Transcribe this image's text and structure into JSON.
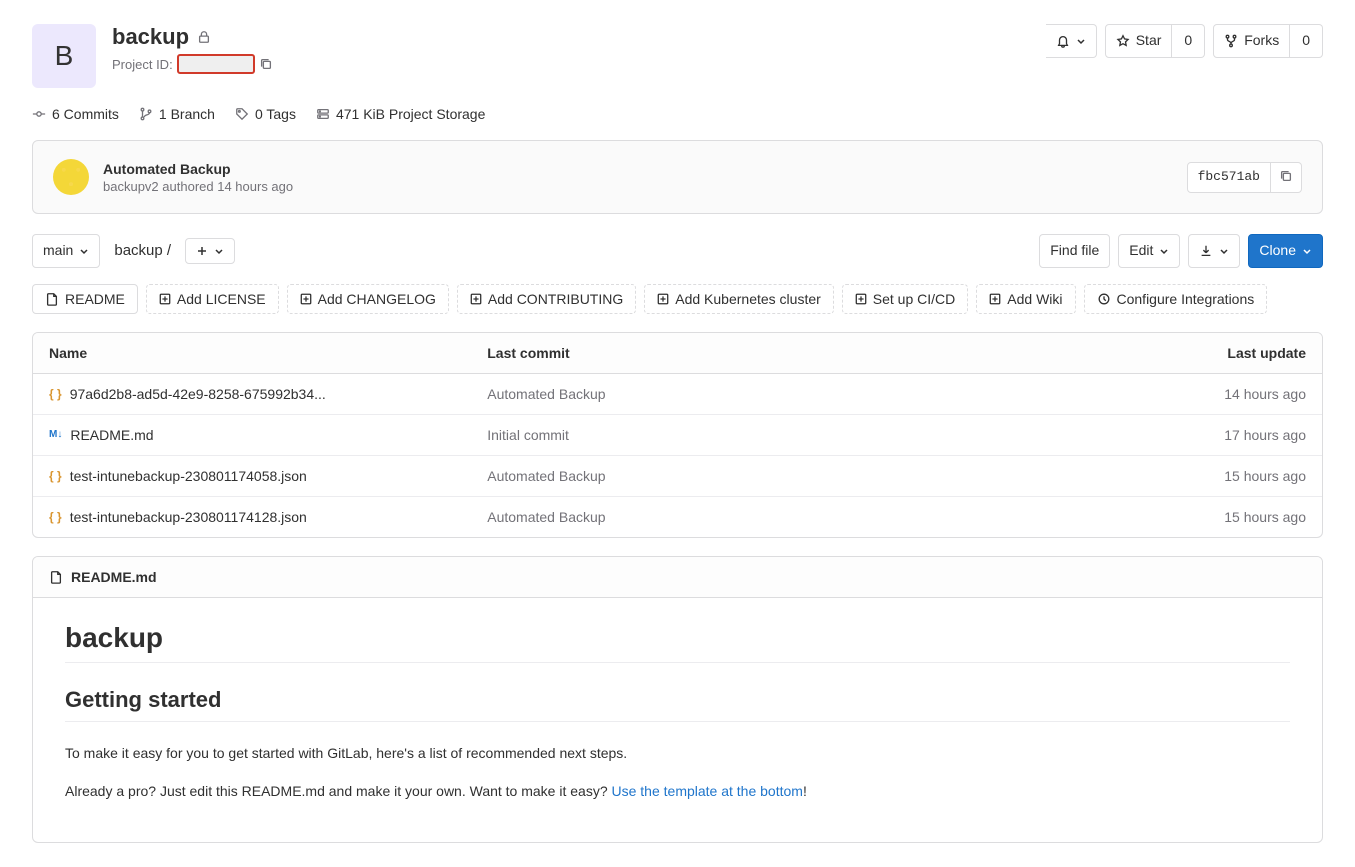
{
  "project": {
    "avatar_letter": "B",
    "name": "backup",
    "id_label": "Project ID:"
  },
  "actions": {
    "star": "Star",
    "star_count": "0",
    "forks": "Forks",
    "forks_count": "0"
  },
  "stats": {
    "commits": "6 Commits",
    "branches": "1 Branch",
    "tags": "0 Tags",
    "storage": "471 KiB Project Storage"
  },
  "last_commit": {
    "title": "Automated Backup",
    "author": "backupv2",
    "verb": "authored",
    "when": "14 hours ago",
    "sha": "fbc571ab"
  },
  "controls": {
    "branch": "main",
    "breadcrumb": "backup",
    "find_file": "Find file",
    "edit": "Edit",
    "clone": "Clone"
  },
  "quick_actions": [
    "README",
    "Add LICENSE",
    "Add CHANGELOG",
    "Add CONTRIBUTING",
    "Add Kubernetes cluster",
    "Set up CI/CD",
    "Add Wiki",
    "Configure Integrations"
  ],
  "table": {
    "headers": {
      "name": "Name",
      "commit": "Last commit",
      "update": "Last update"
    },
    "rows": [
      {
        "icon": "json",
        "name": "97a6d2b8-ad5d-42e9-8258-675992b34...",
        "commit": "Automated Backup",
        "update": "14 hours ago"
      },
      {
        "icon": "md",
        "name": "README.md",
        "commit": "Initial commit",
        "update": "17 hours ago"
      },
      {
        "icon": "json",
        "name": "test-intunebackup-230801174058.json",
        "commit": "Automated Backup",
        "update": "15 hours ago"
      },
      {
        "icon": "json",
        "name": "test-intunebackup-230801174128.json",
        "commit": "Automated Backup",
        "update": "15 hours ago"
      }
    ]
  },
  "readme": {
    "filename": "README.md",
    "h1": "backup",
    "h2": "Getting started",
    "p1": "To make it easy for you to get started with GitLab, here's a list of recommended next steps.",
    "p2a": "Already a pro? Just edit this README.md and make it your own. Want to make it easy? ",
    "p2link": "Use the template at the bottom",
    "p2b": "!"
  }
}
